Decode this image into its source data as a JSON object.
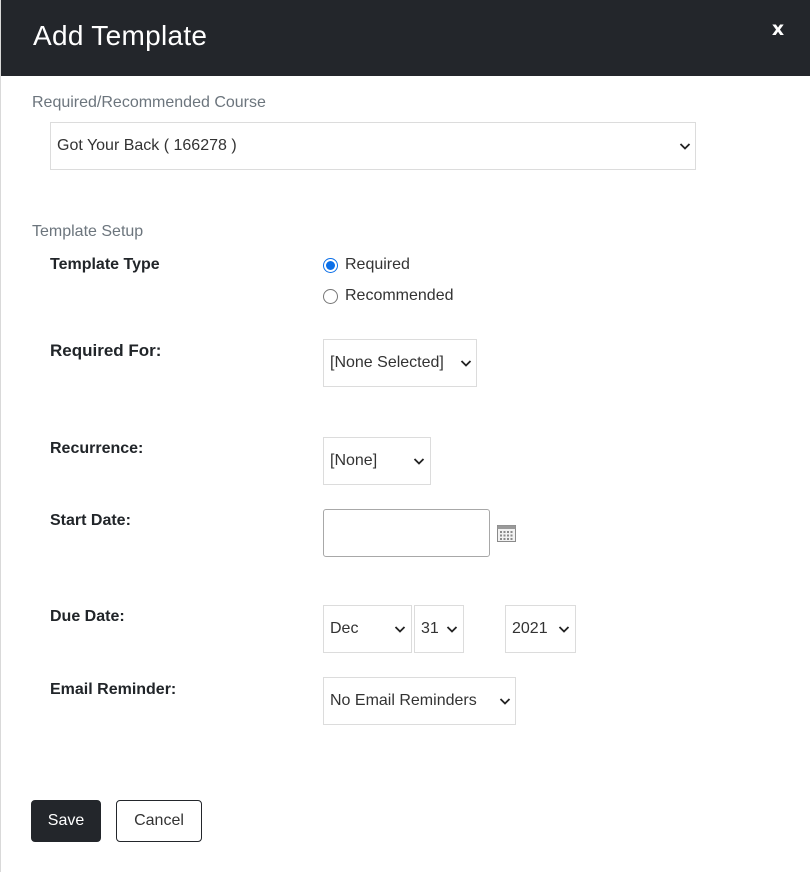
{
  "dialog": {
    "title": "Add Template",
    "close_label": "x"
  },
  "course": {
    "section_label": "Required/Recommended Course",
    "selected": "Got Your Back ( 166278 )"
  },
  "setup": {
    "section_label": "Template Setup",
    "template_type": {
      "label": "Template Type",
      "options": [
        {
          "label": "Required",
          "checked": true
        },
        {
          "label": "Recommended",
          "checked": false
        }
      ]
    },
    "required_for": {
      "label": "Required For:",
      "selected": "[None Selected]"
    },
    "recurrence": {
      "label": "Recurrence:",
      "selected": "[None]"
    },
    "start_date": {
      "label": "Start Date:",
      "value": ""
    },
    "due_date": {
      "label": "Due Date:",
      "month": "Dec",
      "day": "31",
      "year": "2021"
    },
    "email_reminder": {
      "label": "Email Reminder:",
      "selected": "No Email Reminders"
    }
  },
  "actions": {
    "save_label": "Save",
    "cancel_label": "Cancel"
  },
  "colors": {
    "header_bg": "#23262b",
    "radio_accent": "#0b6fe8"
  }
}
